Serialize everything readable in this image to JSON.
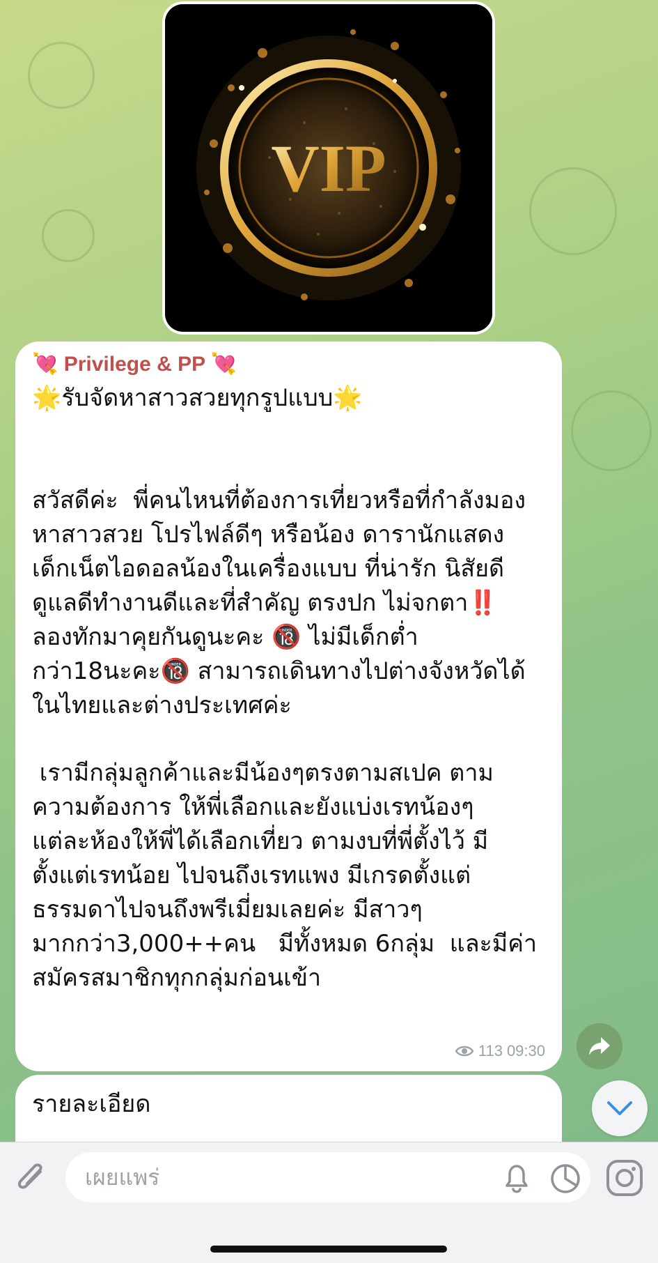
{
  "channel_post": {
    "sender": "💘 Privilege & PP 💘",
    "heading": "🌟รับจัดหาสาวสวยทุกรูปแบบ🌟",
    "paragraph1": [
      "สวัสดีค่ะ  พี่คนไหนที่ต้องการเที่ยวหรือที่กำลังมอง",
      "หาสาวสวย โปรไฟล์ดีๆ หรือน้อง ดารานักแสดง",
      "เด็กเน็ตไอดอลน้องในเครื่องแบบ ที่น่ารัก นิสัยดี",
      "ดูแลดีทำงานดีและที่สำคัญ ตรงปก ไม่จกตา‼️",
      "ลองทักมาคุยกันดูนะคะ 🔞 ไม่มีเด็กต่ำ",
      "กว่า18นะคะ🔞 สามารถเดินทางไปต่างจังหวัดได้",
      "ในไทยและต่างประเทศค่ะ"
    ],
    "paragraph2": [
      " เรามีกลุ่มลูกค้าและมีน้องๆตรงตามสเปค ตาม",
      "ความต้องการ ให้พี่เลือกและยังแบ่งเรทน้องๆ",
      "แต่ละห้องให้พี่ได้เลือกเที่ยว ตามงบที่พี่ตั้งไว้ มี",
      "ตั้งแต่เรทน้อย ไปจนถึงเรทแพง มีเกรดตั้งแต่",
      "ธรรมดาไปจนถึงพรีเมี่ยมเลยค่ะ มีสาวๆ",
      "มากกว่า3,000++คน   มีทั้งหมด 6กลุ่ม  และมีค่า",
      "สมัครสมาชิกทุกกลุ่มก่อนเข้า"
    ],
    "views": "113",
    "time": "09:30"
  },
  "image": {
    "logo_text": "VIP",
    "icon": "vip-badge-image"
  },
  "next_post": {
    "text": "รายละเอียด"
  },
  "input_bar": {
    "placeholder": "เผยแพร่",
    "icons": [
      "paperclip-icon",
      "bell-icon",
      "timer-icon",
      "instagram-icon"
    ]
  },
  "colors": {
    "sender": "#c0504d",
    "meta": "#9aa2aa",
    "bubble": "#ffffff"
  }
}
